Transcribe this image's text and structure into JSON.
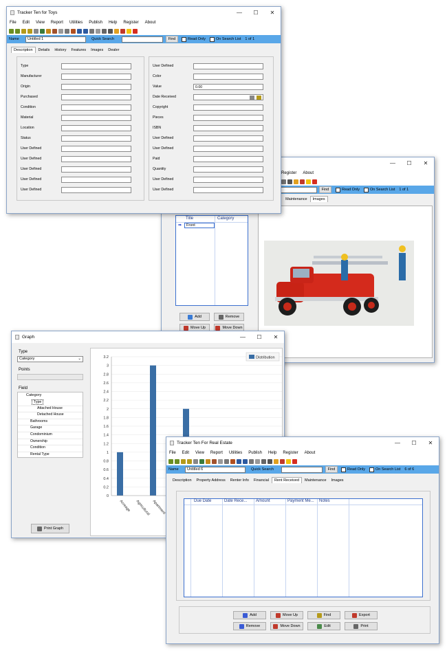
{
  "toys": {
    "title": "Tracker Ten for Toys",
    "menu": [
      "File",
      "Edit",
      "View",
      "Report",
      "Utilities",
      "Publish",
      "Help",
      "Register",
      "About"
    ],
    "name_label": "Name",
    "name_value": "Untitled 1",
    "quick_search": "Quick Search",
    "find": "Find",
    "read_only": "Read Only",
    "on_search_list": "On Search List",
    "record_count": "1 of 1",
    "tabs": [
      "Description",
      "Details",
      "History",
      "Features",
      "Images",
      "Dealer"
    ],
    "left_fields": [
      "Type",
      "Manufacturer",
      "Origin",
      "Purchased",
      "Condition",
      "Material",
      "Location",
      "Status",
      "User Defined",
      "User Defined",
      "User Defined",
      "User Defined",
      "User Defined"
    ],
    "right_fields": [
      "User Defined",
      "Color",
      "Value",
      "Date Received",
      "Copyright",
      "Pieces",
      "ISBN",
      "User Defined",
      "User Defined",
      "Paid",
      "Quantity",
      "User Defined",
      "User Defined"
    ],
    "value_text": "0.00"
  },
  "images_win": {
    "menu": [
      "Register",
      "About"
    ],
    "find": "Find",
    "read_only": "Read Only",
    "on_search_list": "On Search List",
    "record_count": "1 of 1",
    "tabs": [
      "ived",
      "Maintenance",
      "Images"
    ],
    "col_title": "Title",
    "col_category": "Category",
    "row_title": "Front",
    "add": "Add",
    "remove": "Remove",
    "move_up": "Move Up",
    "move_down": "Move Down"
  },
  "graph": {
    "title": "Graph",
    "type_label": "Type",
    "type_value": "Category",
    "points_label": "Points",
    "field_label": "Field",
    "tree_header": "Category",
    "tree_items": [
      "Type",
      "Attached House",
      "Detached House",
      "Bathrooms",
      "Garage",
      "Condominium",
      "Ownership",
      "Condition",
      "Rental Type"
    ],
    "print_graph": "Print Graph",
    "legend": "Distribution",
    "chart_data": {
      "type": "bar",
      "categories": [
        "Acreage",
        "Agricultural",
        "Apartment",
        "Attached House",
        "Detached House",
        "Mobile"
      ],
      "values": [
        1,
        0,
        3,
        0,
        2,
        0
      ],
      "ylim": [
        0,
        3.2
      ],
      "yticks": [
        "0",
        "0.2",
        "0.4",
        "0.6",
        "0.8",
        "1",
        "1.2",
        "1.4",
        "1.6",
        "1.8",
        "2",
        "2.2",
        "2.4",
        "2.6",
        "2.8",
        "3",
        "3.2"
      ],
      "xtick_labels": [
        "Acreage",
        "Agricultural",
        "Apartment",
        "Attached House",
        "Detached House",
        "Mobile"
      ],
      "series": [
        {
          "name": "Distribution",
          "values": [
            1,
            0,
            3,
            0,
            2,
            0
          ]
        }
      ],
      "bar_color": "#3a6ea5",
      "grid": true,
      "legend_position": "top-right"
    }
  },
  "estate": {
    "title": "Tracker Ten For Real Estate",
    "menu": [
      "File",
      "Edit",
      "View",
      "Report",
      "Utilities",
      "Publish",
      "Help",
      "Register",
      "About"
    ],
    "name_label": "Name",
    "name_value": "Untitled 6",
    "quick_search": "Quick Search",
    "find": "Find",
    "read_only": "Read Only",
    "on_search_list": "On Search List",
    "record_count": "6 of 6",
    "tabs": [
      "Description",
      "Property Address",
      "Renter Info",
      "Financial",
      "Rent Received",
      "Maintenance",
      "Images"
    ],
    "columns": [
      "Due Date",
      "Date Rece...",
      "Amount",
      "Payment Me...",
      "Notes"
    ],
    "buttons": [
      "Add",
      "Move Up",
      "Find",
      "Export",
      "Remove",
      "Move Down",
      "Edit",
      "Print"
    ]
  },
  "window_controls": {
    "minimize": "—",
    "maximize": "☐",
    "close": "✕"
  },
  "colors": {
    "namebar": "#59a7e8",
    "bar": "#3a6ea5",
    "grid_border": "#3b6fcf"
  }
}
